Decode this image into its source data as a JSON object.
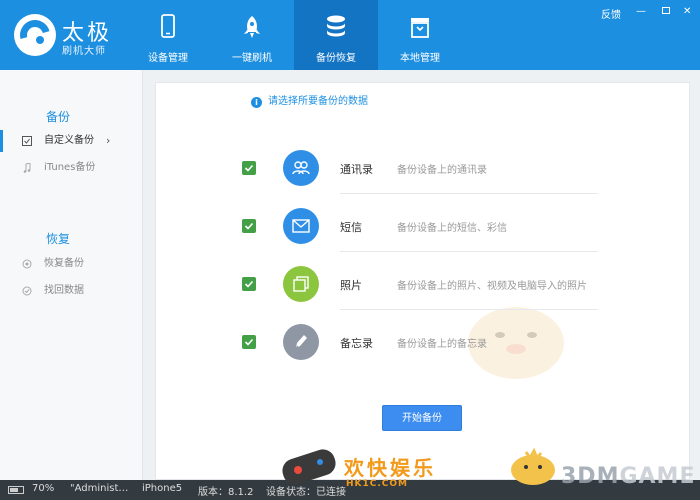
{
  "header": {
    "brand_name": "太极",
    "brand_sub": "刷机大师",
    "tabs": [
      {
        "label": "设备管理",
        "icon": "phone-icon"
      },
      {
        "label": "一键刷机",
        "icon": "rocket-icon"
      },
      {
        "label": "备份恢复",
        "icon": "database-icon",
        "active": true
      },
      {
        "label": "本地管理",
        "icon": "box-icon"
      }
    ],
    "feedback": "反馈",
    "minimize": "—",
    "close": "✕"
  },
  "sidebar": {
    "backup_title": "备份",
    "backup_items": [
      {
        "label": "自定义备份",
        "icon": "custom-backup-icon",
        "active": true,
        "chevron": "›"
      },
      {
        "label": "iTunes备份",
        "icon": "music-note-icon"
      }
    ],
    "restore_title": "恢复",
    "restore_items": [
      {
        "label": "恢复备份",
        "icon": "restore-icon"
      },
      {
        "label": "找回数据",
        "icon": "recover-icon"
      }
    ]
  },
  "main": {
    "info_glyph": "i",
    "hint": "请选择所要备份的数据",
    "rows": [
      {
        "name": "通讯录",
        "desc": "备份设备上的通讯录",
        "icon": "contacts-icon",
        "color": "#2f8fe6",
        "checked": true
      },
      {
        "name": "短信",
        "desc": "备份设备上的短信、彩信",
        "icon": "mail-icon",
        "color": "#2f8fe6",
        "checked": true
      },
      {
        "name": "照片",
        "desc": "备份设备上的照片、视频及电脑导入的照片",
        "icon": "photos-icon",
        "color": "#8cc63e",
        "checked": true
      },
      {
        "name": "备忘录",
        "desc": "备份设备上的备忘录",
        "icon": "pen-icon",
        "color": "#8e97a3",
        "checked": true
      }
    ],
    "start_button": "开始备份"
  },
  "status": {
    "battery": "70%",
    "battery_level": 0.7,
    "user": "\"Administ…",
    "device": "iPhone5",
    "version": "版本：8.1.2",
    "device_state": "设备状态：已连接"
  },
  "watermark": {
    "site_cn": "欢快娱乐",
    "site_url": "HK1C.COM",
    "brand_3dm": "3DM",
    "brand_game": "GAME"
  },
  "colors": {
    "header": "#1c8fe0",
    "active_tab": "#1474c4",
    "checkbox": "#43a047",
    "button": "#3d8df0"
  }
}
